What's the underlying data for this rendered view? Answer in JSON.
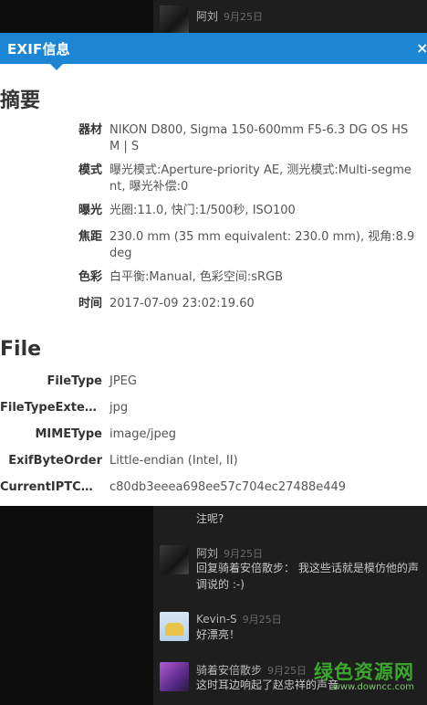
{
  "background_comments": [
    {
      "author": "阿刘",
      "date": "9月25日",
      "body": ""
    },
    {
      "author": "",
      "date": "",
      "body": "注呢?"
    },
    {
      "author": "阿刘",
      "date": "9月25日",
      "body": "回复骑着安倍散步： 我这些话就是模仿他的声调说的 :-)"
    },
    {
      "author": "Kevin-S",
      "date": "9月25日",
      "body": "好漂亮！"
    },
    {
      "author": "骑着安倍散步",
      "date": "9月25日",
      "body": "这时耳边响起了赵忠祥的声音"
    }
  ],
  "modal": {
    "title": "EXIF信息",
    "close": "×",
    "summary": {
      "heading": "摘要",
      "rows": [
        {
          "key": "器材",
          "value": "NIKON D800, Sigma 150-600mm F5-6.3 DG OS HSM | S"
        },
        {
          "key": "模式",
          "value": "曝光模式:Aperture-priority AE, 测光模式:Multi-segment, 曝光补偿:0"
        },
        {
          "key": "曝光",
          "value": "光圈:11.0, 快门:1/500秒, ISO100"
        },
        {
          "key": "焦距",
          "value": "230.0 mm (35 mm equivalent: 230.0 mm), 视角:8.9 deg"
        },
        {
          "key": "色彩",
          "value": "白平衡:Manual, 色彩空间:sRGB"
        },
        {
          "key": "时间",
          "value": "2017-07-09 23:02:19.60"
        }
      ]
    },
    "file": {
      "heading": "File",
      "rows": [
        {
          "key": "FileType",
          "value": "JPEG"
        },
        {
          "key": "FileTypeExten...",
          "value": "jpg"
        },
        {
          "key": "MIMEType",
          "value": "image/jpeg"
        },
        {
          "key": "ExifByteOrder",
          "value": "Little-endian (Intel, II)"
        },
        {
          "key": "CurrentIPTCD...",
          "value": "c80db3eeea698ee57c704ec27488e449"
        }
      ]
    }
  },
  "watermark": {
    "name": "绿色资源网",
    "url": "www.downcc.com"
  }
}
